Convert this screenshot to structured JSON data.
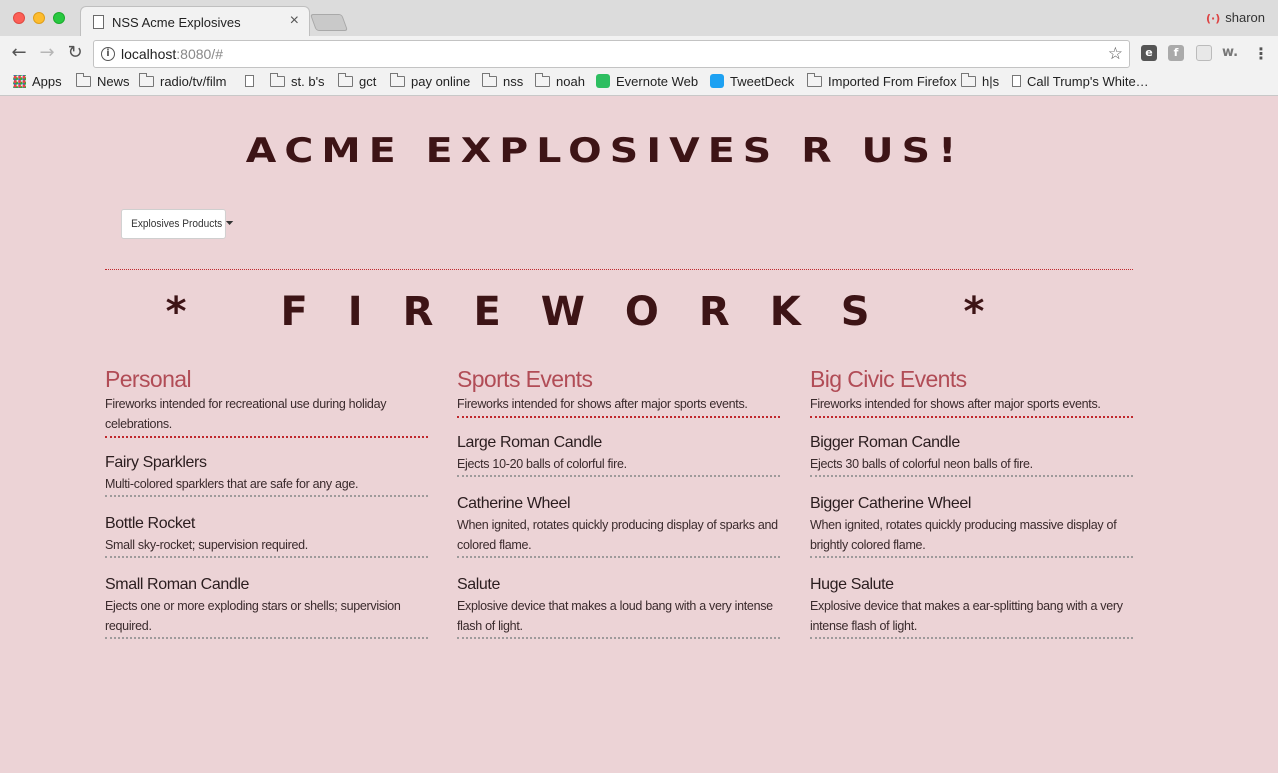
{
  "browser": {
    "tab_title": "NSS Acme Explosives",
    "tab_close": "×",
    "profile_name": "sharon",
    "url_host": "localhost",
    "url_rest": ":8080/#",
    "bookmarks": [
      {
        "label": "Apps",
        "icon": "apps-grid-icon"
      },
      {
        "label": "News",
        "icon": "folder-icon"
      },
      {
        "label": "radio/tv/film",
        "icon": "folder-icon"
      },
      {
        "label": "",
        "icon": "page-icon"
      },
      {
        "label": "st. b's",
        "icon": "folder-icon"
      },
      {
        "label": "gct",
        "icon": "folder-icon"
      },
      {
        "label": "pay online",
        "icon": "folder-icon"
      },
      {
        "label": "nss",
        "icon": "folder-icon"
      },
      {
        "label": "noah",
        "icon": "folder-icon"
      },
      {
        "label": "Evernote Web",
        "icon": "evernote-icon"
      },
      {
        "label": "TweetDeck",
        "icon": "tweetdeck-icon"
      },
      {
        "label": "Imported From Firefox",
        "icon": "folder-icon"
      },
      {
        "label": "h|s",
        "icon": "folder-icon"
      },
      {
        "label": "Call Trump's White…",
        "icon": "page-icon"
      }
    ]
  },
  "page": {
    "site_title": "ACME EXPLOSIVES R US!",
    "dropdown_label": "Explosives Products",
    "section_heading": "* FIREWORKS *",
    "categories": [
      {
        "title": "Personal",
        "description": "Fireworks intended for recreational use during holiday celebrations.",
        "products": [
          {
            "name": "Fairy Sparklers",
            "description": "Multi-colored sparklers that are safe for any age."
          },
          {
            "name": "Bottle Rocket",
            "description": "Small sky-rocket; supervision required."
          },
          {
            "name": "Small Roman Candle",
            "description": "Ejects one or more exploding stars or shells; supervision required."
          }
        ]
      },
      {
        "title": "Sports Events",
        "description": "Fireworks intended for shows after major sports events.",
        "products": [
          {
            "name": "Large Roman Candle",
            "description": "Ejects 10-20 balls of colorful fire."
          },
          {
            "name": "Catherine Wheel",
            "description": "When ignited, rotates quickly producing display of sparks and colored flame."
          },
          {
            "name": "Salute",
            "description": "Explosive device that makes a loud bang with a very intense flash of light."
          }
        ]
      },
      {
        "title": "Big Civic Events",
        "description": "Fireworks intended for shows after major sports events.",
        "products": [
          {
            "name": "Bigger Roman Candle",
            "description": "Ejects 30 balls of colorful neon balls of fire."
          },
          {
            "name": "Bigger Catherine Wheel",
            "description": "When ignited, rotates quickly producing massive display of brightly colored flame."
          },
          {
            "name": "Huge Salute",
            "description": "Explosive device that makes a ear-splitting bang with a very intense flash of light."
          }
        ]
      }
    ]
  }
}
